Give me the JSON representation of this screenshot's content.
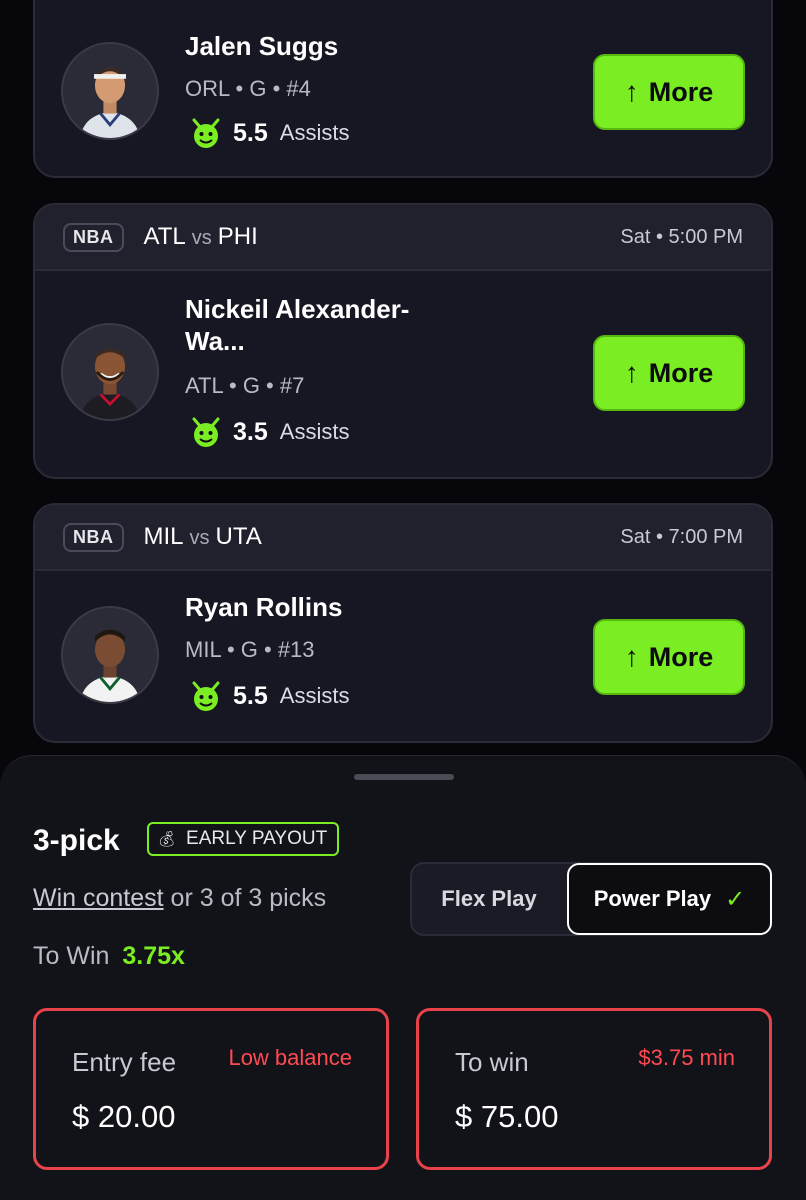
{
  "players": [
    {
      "name": "Jalen Suggs",
      "meta": "ORL • G • #4",
      "line": "5.5",
      "stat": "Assists",
      "button": "More",
      "jersey_color": "#dfe3ea"
    },
    {
      "league": "NBA",
      "team_a": "ATL",
      "vs": "vs",
      "team_b": "PHI",
      "time": "Sat • 5:00 PM",
      "name": "Nickeil Alexander-Wa...",
      "meta": "ATL • G • #7",
      "line": "3.5",
      "stat": "Assists",
      "button": "More",
      "jersey_color": "#1c1c22"
    },
    {
      "league": "NBA",
      "team_a": "MIL",
      "vs": "vs",
      "team_b": "UTA",
      "time": "Sat • 7:00 PM",
      "name": "Ryan Rollins",
      "meta": "MIL • G • #13",
      "line": "5.5",
      "stat": "Assists",
      "button": "More",
      "jersey_color": "#f2f2f2"
    }
  ],
  "sheet": {
    "pick_title": "3-pick",
    "early_payout": "EARLY PAYOUT",
    "win_contest_link": "Win contest",
    "win_rest": " or 3 of 3 picks",
    "to_win_label": "To Win",
    "multiplier": "3.75x",
    "flex_label": "Flex Play",
    "power_label": "Power Play",
    "entry_label": "Entry fee",
    "entry_warning": "Low balance",
    "entry_value": "$ 20.00",
    "towin_box_label": "To win",
    "towin_min": "$3.75 min",
    "towin_value": "$ 75.00"
  },
  "colors": {
    "accent_green": "#7aee22",
    "error_red": "#e8434a",
    "background": "#07070b",
    "card": "#161722"
  },
  "icons": {
    "goblin": "goblin-icon",
    "check": "check-icon",
    "arrow": "arrow-up-icon",
    "money_bag": "money-bag-icon"
  }
}
